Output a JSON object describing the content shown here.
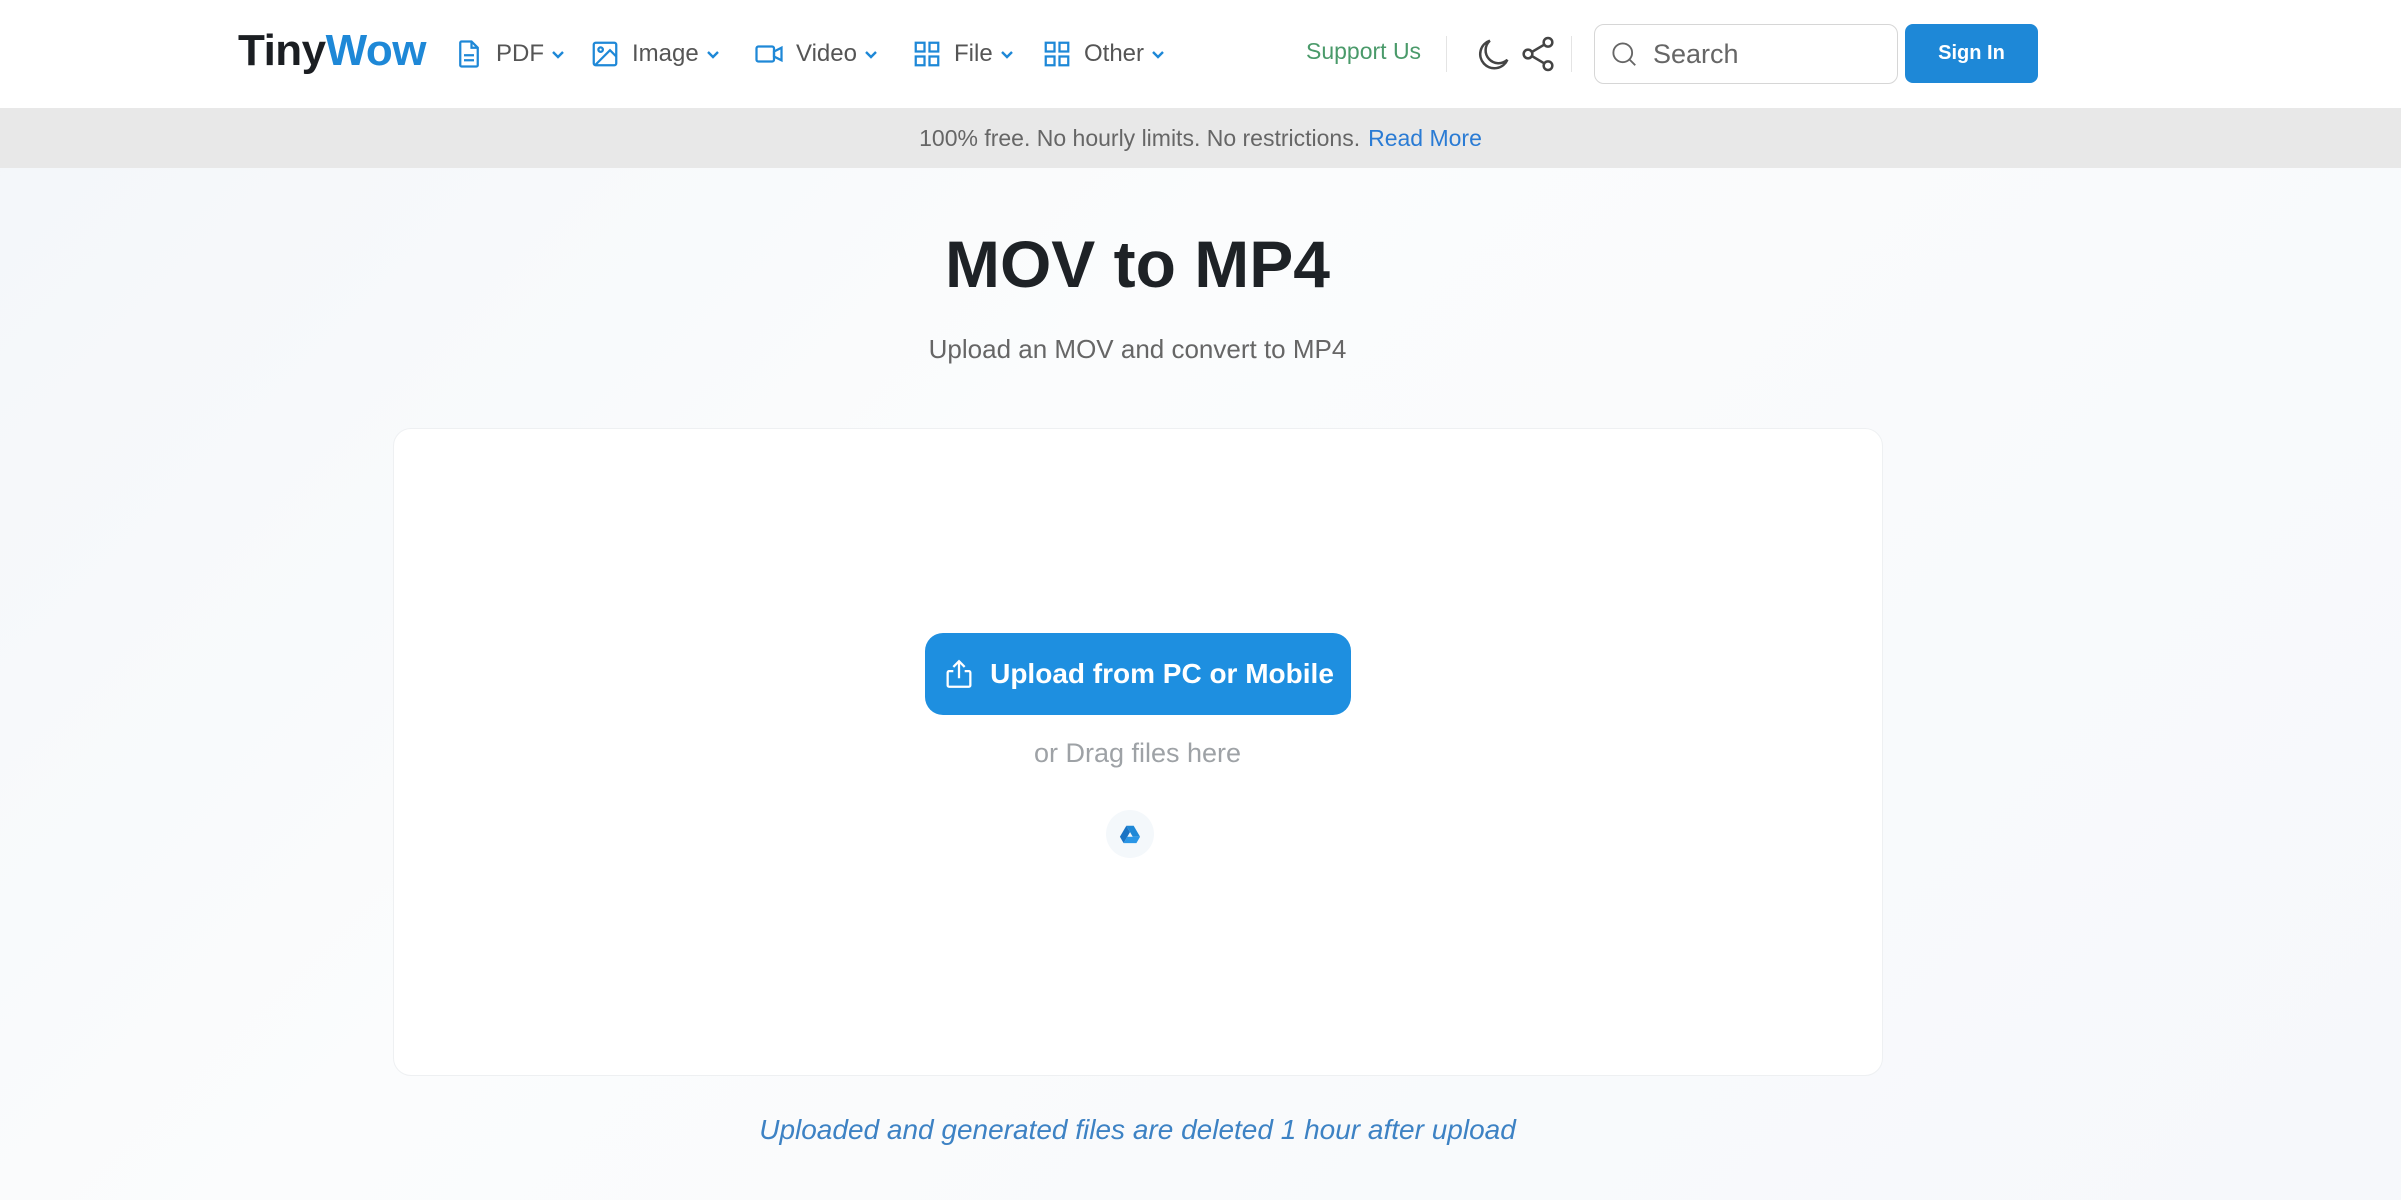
{
  "header": {
    "logo_part1": "Tiny",
    "logo_part2": "Wow",
    "nav": [
      {
        "label": "PDF",
        "icon": "file-document-icon"
      },
      {
        "label": "Image",
        "icon": "image-icon"
      },
      {
        "label": "Video",
        "icon": "video-camera-icon"
      },
      {
        "label": "File",
        "icon": "grid-icon"
      },
      {
        "label": "Other",
        "icon": "grid-icon"
      }
    ],
    "support_label": "Support Us",
    "search_placeholder": "Search",
    "signin_label": "Sign In"
  },
  "banner": {
    "text": "100% free. No hourly limits. No restrictions.",
    "link": "Read More"
  },
  "main": {
    "title": "MOV to MP4",
    "subtitle": "Upload an MOV and convert to MP4",
    "upload_label": "Upload from PC or Mobile",
    "drag_text": "or Drag files here",
    "footnote": "Uploaded and generated files are deleted 1 hour after upload"
  },
  "colors": {
    "accent": "#1e88d7",
    "support": "#4a9a6a",
    "banner_bg": "#e8e8e8"
  }
}
